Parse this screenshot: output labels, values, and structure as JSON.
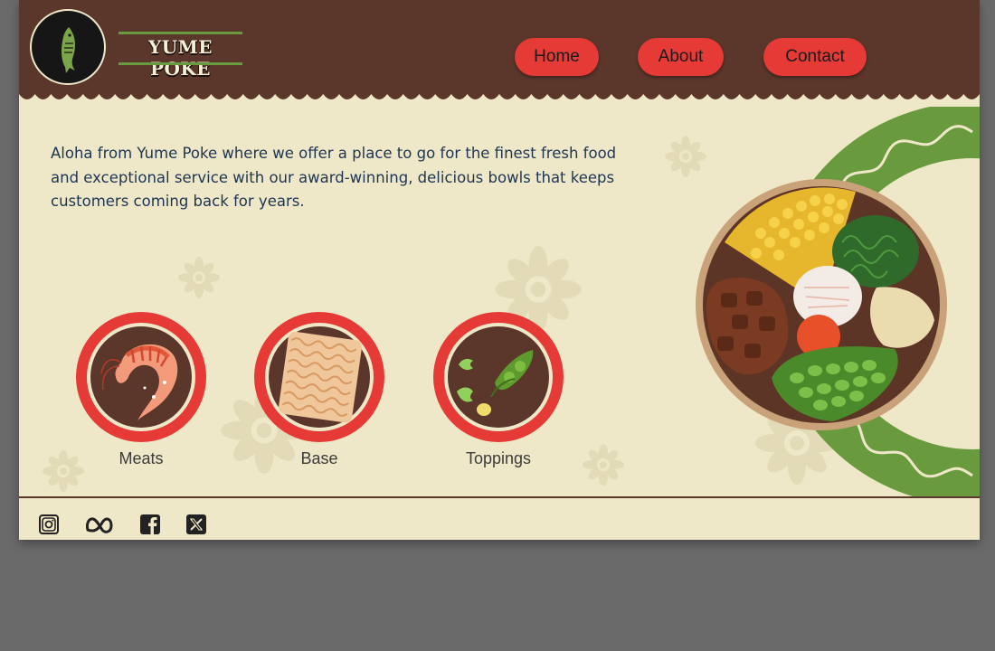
{
  "brand": {
    "name": "YUME POKE",
    "logo_icon": "fish-icon"
  },
  "nav": {
    "items": [
      {
        "label": "Home"
      },
      {
        "label": "About"
      },
      {
        "label": "Contact"
      }
    ]
  },
  "intro": {
    "text": "Aloha from Yume Poke where we offer a place to go for the finest fresh food and exceptional service with our award-winning, delicious bowls that keeps customers coming back for years."
  },
  "categories": [
    {
      "label": "Meats",
      "icon": "shrimp-icon"
    },
    {
      "label": "Base",
      "icon": "noodles-icon"
    },
    {
      "label": "Toppings",
      "icon": "edamame-icon"
    }
  ],
  "footer": {
    "social": [
      "instagram-icon",
      "meta-icon",
      "facebook-icon",
      "x-icon"
    ]
  },
  "colors": {
    "header_brown": "#5a362b",
    "cream": "#efe8c8",
    "red_accent": "#e53a35",
    "green_accent": "#6a9a3e",
    "text_navy": "#1d3554"
  }
}
